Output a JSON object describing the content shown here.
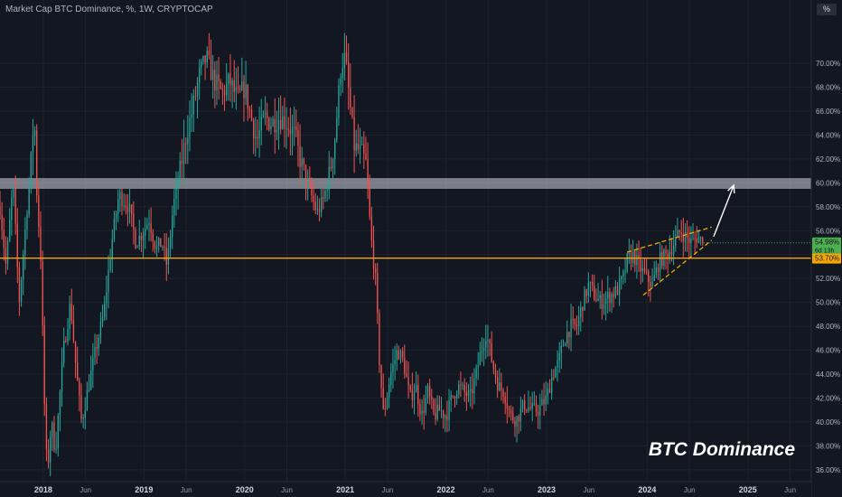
{
  "header": {
    "title": "Market Cap BTC Dominance, %, 1W, CRYPTOCAP",
    "unit_badge": "%"
  },
  "watermark": "BTC Dominance",
  "colors": {
    "background": "#131722",
    "up": "#26a69a",
    "down": "#ef5350",
    "support": "#f7a600",
    "channel": "#f7a600",
    "resistance_band": "#d1d4dc",
    "price_label": "#4caf50",
    "text": "#787b86"
  },
  "chart_data": {
    "type": "candlestick",
    "timeframe": "1W",
    "xlim": [
      2017.57,
      2025.63
    ],
    "ylim": [
      35.0,
      75.3
    ],
    "y_ticks": [
      "36.00%",
      "38.00%",
      "40.00%",
      "42.00%",
      "44.00%",
      "46.00%",
      "48.00%",
      "50.00%",
      "52.00%",
      "54.00%",
      "56.00%",
      "58.00%",
      "60.00%",
      "62.00%",
      "64.00%",
      "66.00%",
      "68.00%",
      "70.00%"
    ],
    "y_tick_values": [
      36,
      38,
      40,
      42,
      44,
      46,
      48,
      50,
      52,
      54,
      56,
      58,
      60,
      62,
      64,
      66,
      68,
      70
    ],
    "x_ticks": [
      {
        "label": "2018",
        "t": 2018.0,
        "bold": true
      },
      {
        "label": "Jun",
        "t": 2018.42,
        "bold": false
      },
      {
        "label": "2019",
        "t": 2019.0,
        "bold": true
      },
      {
        "label": "Jun",
        "t": 2019.42,
        "bold": false
      },
      {
        "label": "2020",
        "t": 2020.0,
        "bold": true
      },
      {
        "label": "Jun",
        "t": 2020.42,
        "bold": false
      },
      {
        "label": "2021",
        "t": 2021.0,
        "bold": true
      },
      {
        "label": "Jun",
        "t": 2021.42,
        "bold": false
      },
      {
        "label": "2022",
        "t": 2022.0,
        "bold": true
      },
      {
        "label": "Jun",
        "t": 2022.42,
        "bold": false
      },
      {
        "label": "2023",
        "t": 2023.0,
        "bold": true
      },
      {
        "label": "Jun",
        "t": 2023.42,
        "bold": false
      },
      {
        "label": "2024",
        "t": 2024.0,
        "bold": true
      },
      {
        "label": "Jun",
        "t": 2024.42,
        "bold": false
      },
      {
        "label": "2025",
        "t": 2025.0,
        "bold": true
      },
      {
        "label": "Jun",
        "t": 2025.42,
        "bold": false
      }
    ],
    "anchors": [
      [
        2017.57,
        58
      ],
      [
        2017.63,
        53
      ],
      [
        2017.7,
        60
      ],
      [
        2017.76,
        50
      ],
      [
        2017.82,
        56
      ],
      [
        2017.88,
        62
      ],
      [
        2017.91,
        66
      ],
      [
        2017.94,
        58
      ],
      [
        2017.97,
        55
      ],
      [
        2018.02,
        39
      ],
      [
        2018.04,
        35.8
      ],
      [
        2018.08,
        40
      ],
      [
        2018.12,
        37.5
      ],
      [
        2018.2,
        46
      ],
      [
        2018.27,
        50
      ],
      [
        2018.33,
        44
      ],
      [
        2018.38,
        40
      ],
      [
        2018.45,
        43
      ],
      [
        2018.52,
        46
      ],
      [
        2018.6,
        49
      ],
      [
        2018.68,
        55
      ],
      [
        2018.75,
        59
      ],
      [
        2018.85,
        58
      ],
      [
        2018.92,
        55
      ],
      [
        2019.0,
        56
      ],
      [
        2019.05,
        57
      ],
      [
        2019.12,
        54.5
      ],
      [
        2019.18,
        55
      ],
      [
        2019.23,
        53
      ],
      [
        2019.29,
        58
      ],
      [
        2019.35,
        60.5
      ],
      [
        2019.42,
        64
      ],
      [
        2019.48,
        66
      ],
      [
        2019.55,
        69
      ],
      [
        2019.62,
        70.5
      ],
      [
        2019.7,
        68.5
      ],
      [
        2019.78,
        67.5
      ],
      [
        2019.85,
        68.5
      ],
      [
        2019.93,
        67
      ],
      [
        2020.0,
        68
      ],
      [
        2020.05,
        66
      ],
      [
        2020.12,
        63.5
      ],
      [
        2020.2,
        65.5
      ],
      [
        2020.27,
        65
      ],
      [
        2020.35,
        65.5
      ],
      [
        2020.42,
        65
      ],
      [
        2020.5,
        64
      ],
      [
        2020.55,
        62
      ],
      [
        2020.62,
        60
      ],
      [
        2020.68,
        58.5
      ],
      [
        2020.72,
        57.5
      ],
      [
        2020.78,
        58.5
      ],
      [
        2020.85,
        61
      ],
      [
        2020.9,
        64
      ],
      [
        2020.96,
        70
      ],
      [
        2021.0,
        70.5
      ],
      [
        2021.04,
        67
      ],
      [
        2021.09,
        63
      ],
      [
        2021.16,
        62.5
      ],
      [
        2021.21,
        61.5
      ],
      [
        2021.25,
        56
      ],
      [
        2021.3,
        52
      ],
      [
        2021.34,
        45
      ],
      [
        2021.38,
        40.5
      ],
      [
        2021.45,
        44
      ],
      [
        2021.52,
        46
      ],
      [
        2021.58,
        45
      ],
      [
        2021.64,
        42
      ],
      [
        2021.7,
        43
      ],
      [
        2021.76,
        40.5
      ],
      [
        2021.82,
        42.5
      ],
      [
        2021.88,
        40.5
      ],
      [
        2021.94,
        41
      ],
      [
        2022.0,
        40.5
      ],
      [
        2022.06,
        42
      ],
      [
        2022.12,
        43
      ],
      [
        2022.18,
        42.5
      ],
      [
        2022.24,
        42
      ],
      [
        2022.3,
        44
      ],
      [
        2022.35,
        46
      ],
      [
        2022.4,
        47.5
      ],
      [
        2022.46,
        45
      ],
      [
        2022.52,
        43
      ],
      [
        2022.58,
        42.5
      ],
      [
        2022.64,
        40.5
      ],
      [
        2022.7,
        40.2
      ],
      [
        2022.78,
        41.5
      ],
      [
        2022.85,
        41
      ],
      [
        2022.92,
        41
      ],
      [
        2023.0,
        42
      ],
      [
        2023.06,
        44
      ],
      [
        2023.12,
        45
      ],
      [
        2023.18,
        47
      ],
      [
        2023.24,
        48
      ],
      [
        2023.3,
        48
      ],
      [
        2023.36,
        50
      ],
      [
        2023.42,
        51.5
      ],
      [
        2023.48,
        50.5
      ],
      [
        2023.54,
        50
      ],
      [
        2023.62,
        50.5
      ],
      [
        2023.7,
        51
      ],
      [
        2023.76,
        52
      ],
      [
        2023.8,
        53.5
      ],
      [
        2023.86,
        54
      ],
      [
        2023.92,
        53
      ],
      [
        2024.0,
        52
      ],
      [
        2024.05,
        51.5
      ],
      [
        2024.12,
        53.5
      ],
      [
        2024.2,
        54
      ],
      [
        2024.27,
        55
      ],
      [
        2024.33,
        56
      ],
      [
        2024.38,
        55.5
      ],
      [
        2024.44,
        55
      ],
      [
        2024.5,
        55.5
      ],
      [
        2024.56,
        54.98
      ]
    ],
    "last_price": {
      "value": 54.98,
      "label": "54.98%",
      "countdown": "6d 13h"
    },
    "support_level": {
      "value": 53.7,
      "label": "53.70%"
    },
    "resistance_zone": {
      "low": 59.5,
      "high": 60.4
    },
    "rising_wedge": {
      "upper": [
        [
          2023.8,
          54.2
        ],
        [
          2024.64,
          56.3
        ]
      ],
      "lower": [
        [
          2023.96,
          50.6
        ],
        [
          2024.64,
          55.2
        ]
      ]
    },
    "projection_arrow": {
      "from": [
        2024.66,
        55.5
      ],
      "to": [
        2024.86,
        59.8
      ]
    }
  }
}
